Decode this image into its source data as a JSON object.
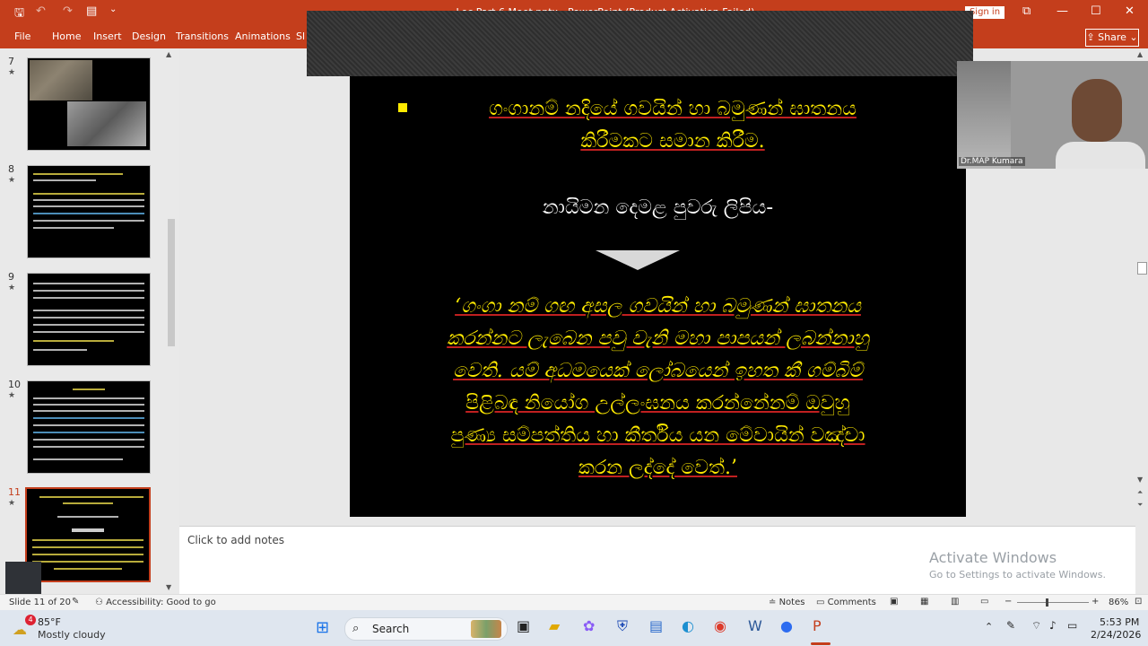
{
  "titlebar": {
    "title": "...Lec Part 6 Meet.pptx - PowerPoint (Product Activation Failed)",
    "signin": "Sign in",
    "qa": {
      "save": "🖫",
      "undo": "↶",
      "redo": "↷",
      "more": "⌄"
    },
    "win": {
      "restore": "⧉",
      "minimize": "—",
      "maximize": "☐",
      "close": "✕"
    }
  },
  "ribbon": {
    "tabs": [
      "File",
      "Home",
      "Insert",
      "Design",
      "Transitions",
      "Animations",
      "Sl"
    ],
    "share": "Share"
  },
  "thumbnails": [
    {
      "num": "7",
      "star": "★"
    },
    {
      "num": "8",
      "star": "★"
    },
    {
      "num": "9",
      "star": "★"
    },
    {
      "num": "10",
      "star": "★"
    },
    {
      "num": "11",
      "star": "★"
    }
  ],
  "slide": {
    "bullet_line1": "ගංගානම් නදියේ ගවයින් හා බමුණන් ඝාතනය",
    "bullet_line2": "කිරීමකට සමාන කිරීම.",
    "heading": "නායිමන දෙමළ පුවරු ලිපිය-",
    "quote": [
      "‘ගංගා නම් ගඟ අසල  ගවයින් හා බමුණන් ඝාතනය",
      "කරන්නට ලැබෙන පවු වැනි මහා පාපයන් ලබන්නාහු",
      "වෙති. යම් අධමයෙක් ලෝබයෙන් ඉහත කී ගම්බිම්",
      "පිළිබඳ නියෝග උල්ලංඝනය කරන්නේනම් ඔවුහු",
      "පුණ්‍ය සම්පත්තිය හා කීර්තිය යන මේවායින් වඤ්චා",
      "කරන ලද්දේ වෙත්.’"
    ]
  },
  "notes": {
    "placeholder": "Click to add notes"
  },
  "webcam": {
    "name": "Dr.MAP Kumara"
  },
  "watermark": {
    "line1": "Activate Windows",
    "line2": "Go to Settings to activate Windows."
  },
  "status": {
    "slide": "Slide 11 of 20",
    "accessibility": "Accessibility: Good to go",
    "notes": "Notes",
    "comments": "Comments",
    "zoom": "86%"
  },
  "taskbar": {
    "weather_badge": "4",
    "temp": "85°F",
    "weather": "Mostly cloudy",
    "search": "Search",
    "time": "5:53 PM",
    "date": "2/24/2026"
  },
  "colors": {
    "accent": "#c43e1c",
    "slide_bg": "#000000",
    "slide_yellow": "#ffea00"
  }
}
